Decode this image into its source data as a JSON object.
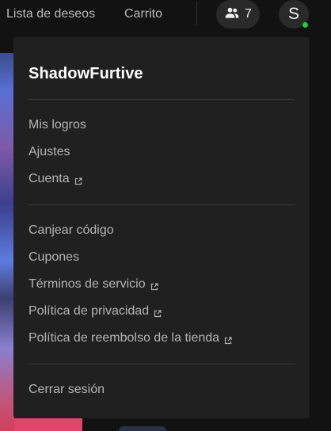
{
  "nav": {
    "wishlist_label": "Lista de deseos",
    "cart_label": "Carrito",
    "friends_count": "7",
    "avatar_initial": "S"
  },
  "colors": {
    "online_status": "#27c93f",
    "dropdown_bg": "#202020"
  },
  "menu": {
    "username": "ShadowFurtive",
    "section1": [
      {
        "label": "Mis logros",
        "external": false
      },
      {
        "label": "Ajustes",
        "external": false
      },
      {
        "label": "Cuenta",
        "external": true
      }
    ],
    "section2": [
      {
        "label": "Canjear código",
        "external": false
      },
      {
        "label": "Cupones",
        "external": false
      },
      {
        "label": "Términos de servicio",
        "external": true
      },
      {
        "label": "Política de privacidad",
        "external": true
      },
      {
        "label": "Política de reembolso de la tienda",
        "external": true
      }
    ],
    "signout_label": "Cerrar sesión"
  }
}
